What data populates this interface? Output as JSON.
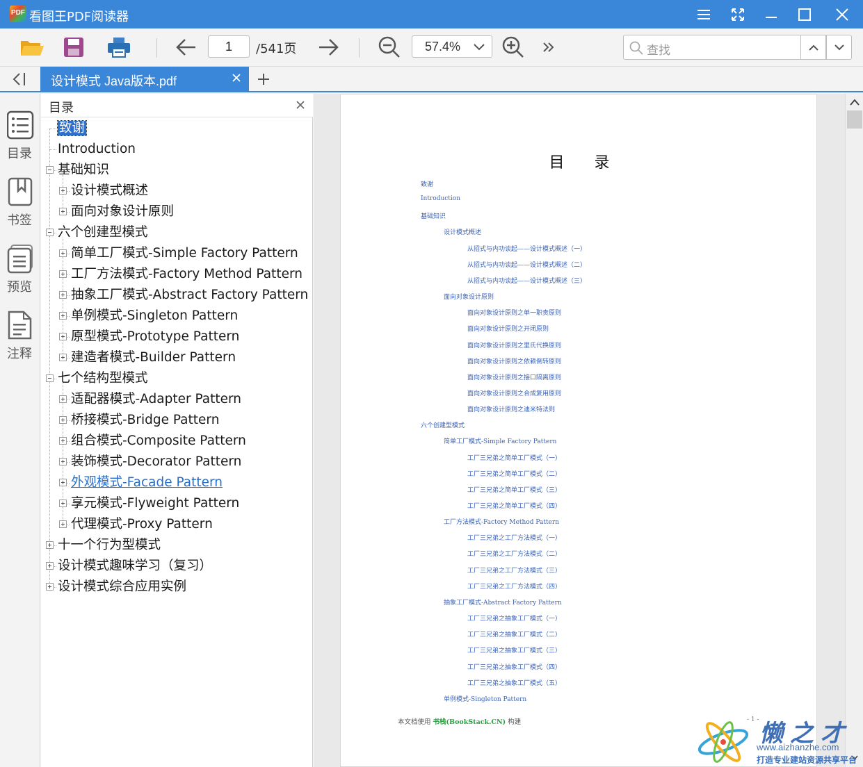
{
  "app": {
    "logo_text": "PDF",
    "title": "看图王PDF阅读器"
  },
  "toolbar": {
    "current_page": "1",
    "total_pages": "/541页",
    "zoom": "57.4%",
    "search_placeholder": "查找"
  },
  "tab": {
    "title": "设计模式 Java版本.pdf"
  },
  "rail": {
    "items": [
      "目录",
      "书签",
      "预览",
      "注释"
    ]
  },
  "outline": {
    "title": "目录",
    "nodes": [
      {
        "label": "致谢"
      },
      {
        "label": "Introduction"
      },
      {
        "label": "基础知识"
      },
      {
        "label": "设计模式概述"
      },
      {
        "label": "面向对象设计原则"
      },
      {
        "label": "六个创建型模式"
      },
      {
        "label": "简单工厂模式-Simple Factory Pattern"
      },
      {
        "label": "工厂方法模式-Factory Method Pattern"
      },
      {
        "label": "抽象工厂模式-Abstract Factory Pattern"
      },
      {
        "label": "单例模式-Singleton Pattern"
      },
      {
        "label": "原型模式-Prototype Pattern"
      },
      {
        "label": "建造者模式-Builder Pattern"
      },
      {
        "label": "七个结构型模式"
      },
      {
        "label": "适配器模式-Adapter Pattern"
      },
      {
        "label": "桥接模式-Bridge Pattern"
      },
      {
        "label": "组合模式-Composite Pattern"
      },
      {
        "label": "装饰模式-Decorator Pattern"
      },
      {
        "label": "外观模式-Facade Pattern"
      },
      {
        "label": "享元模式-Flyweight Pattern"
      },
      {
        "label": "代理模式-Proxy Pattern"
      },
      {
        "label": "十一个行为型模式"
      },
      {
        "label": "设计模式趣味学习（复习）"
      },
      {
        "label": "设计模式综合应用实例"
      }
    ]
  },
  "page": {
    "heading": "目 录",
    "toc": [
      "致谢",
      "Introduction",
      "基础知识",
      "设计模式概述",
      "从招式与内功谈起——设计模式概述（一）",
      "从招式与内功谈起——设计模式概述（二）",
      "从招式与内功谈起——设计模式概述（三）",
      "面向对象设计原则",
      "面向对象设计原则之单一职责原则",
      "面向对象设计原则之开闭原则",
      "面向对象设计原则之里氏代换原则",
      "面向对象设计原则之依赖倒转原则",
      "面向对象设计原则之接口隔离原则",
      "面向对象设计原则之合成复用原则",
      "面向对象设计原则之迪米特法则",
      "六个创建型模式",
      "简单工厂模式-Simple Factory Pattern",
      "工厂三兄弟之简单工厂模式（一）",
      "工厂三兄弟之简单工厂模式（二）",
      "工厂三兄弟之简单工厂模式（三）",
      "工厂三兄弟之简单工厂模式（四）",
      "工厂方法模式-Factory Method Pattern",
      "工厂三兄弟之工厂方法模式（一）",
      "工厂三兄弟之工厂方法模式（二）",
      "工厂三兄弟之工厂方法模式（三）",
      "工厂三兄弟之工厂方法模式（四）",
      "抽象工厂模式-Abstract Factory Pattern",
      "工厂三兄弟之抽象工厂模式（一）",
      "工厂三兄弟之抽象工厂模式（二）",
      "工厂三兄弟之抽象工厂模式（三）",
      "工厂三兄弟之抽象工厂模式（四）",
      "工厂三兄弟之抽象工厂模式（五）",
      "单例模式-Singleton Pattern"
    ],
    "footer_prefix": "本文档使用",
    "footer_brand": "书栈(BookStack.CN)",
    "footer_suffix": "构建",
    "page_number": "- 1 -"
  },
  "watermark": {
    "name": "懒之才",
    "url": "www.aizhanzhe.com",
    "slogan": "打造专业建站资源共享平台"
  },
  "colors": {
    "accent": "#3a86d9",
    "toc_link": "#3b63b8",
    "selected": "#2b6fcf"
  },
  "icons": [
    "open-folder-icon",
    "save-icon",
    "print-icon",
    "arrow-left-icon",
    "arrow-right-icon",
    "zoom-out-icon",
    "zoom-in-icon",
    "more-icon",
    "search-icon"
  ]
}
